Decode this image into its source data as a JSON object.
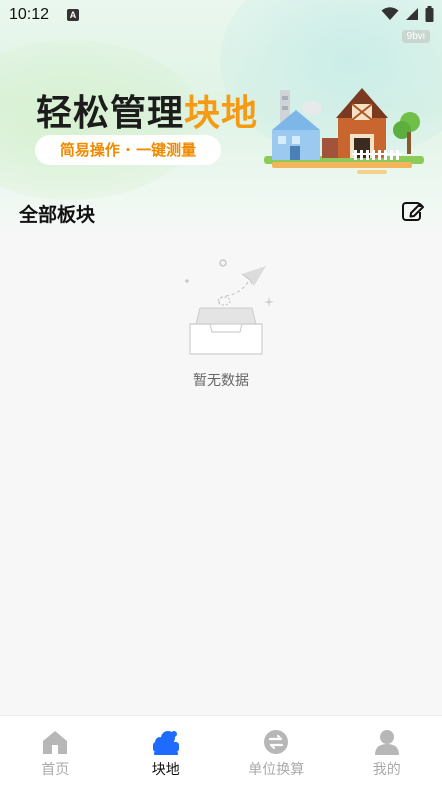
{
  "status_bar": {
    "time": "10:12",
    "notification_letter": "A",
    "icons": [
      "wifi-icon",
      "signal-icon",
      "battery-icon"
    ]
  },
  "badge": "9bvi",
  "banner": {
    "title_main": "轻松管理",
    "title_highlight": "块地",
    "subtitle": "简易操作 · 一键测量",
    "colors": {
      "highlight": "#f59a12",
      "subtitle": "#f08a00"
    }
  },
  "section": {
    "title": "全部板块",
    "edit_icon": "edit-icon"
  },
  "empty_state": {
    "text": "暂无数据",
    "icon": "empty-inbox-icon"
  },
  "tabbar": {
    "active_color": "#1f6bff",
    "inactive_color": "#b7b7b7",
    "items": [
      {
        "label": "首页",
        "icon": "home-icon",
        "active": false
      },
      {
        "label": "块地",
        "icon": "land-icon",
        "active": true
      },
      {
        "label": "单位换算",
        "icon": "exchange-icon",
        "active": false
      },
      {
        "label": "我的",
        "icon": "user-icon",
        "active": false
      }
    ]
  }
}
